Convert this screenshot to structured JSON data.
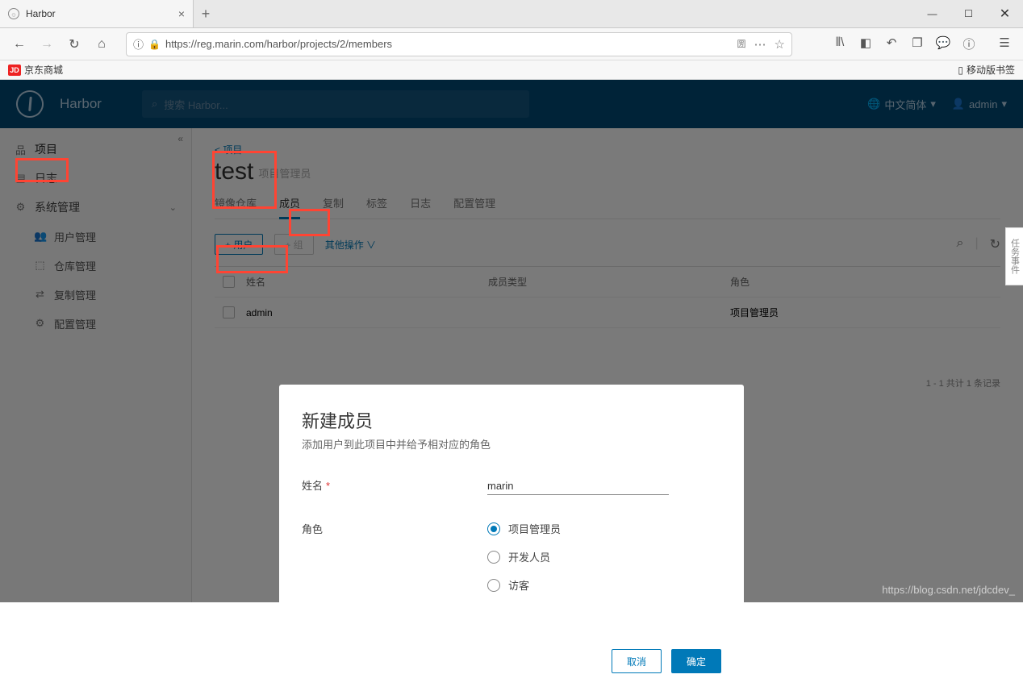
{
  "browser": {
    "tab_title": "Harbor",
    "url": "https://reg.marin.com/harbor/projects/2/members",
    "bookmark1": "京东商城",
    "bookmark2": "移动版书签"
  },
  "header": {
    "brand": "Harbor",
    "search_placeholder": "搜索 Harbor...",
    "lang": "中文简体",
    "user": "admin"
  },
  "sidebar": {
    "projects": "项目",
    "logs": "日志",
    "admin": "系统管理",
    "users": "用户管理",
    "repos": "仓库管理",
    "replication": "复制管理",
    "config": "配置管理"
  },
  "main": {
    "crumb": "< 项目",
    "title": "test",
    "subtitle": "项目管理员",
    "tabs": {
      "repo": "镜像仓库",
      "members": "成员",
      "replication": "复制",
      "labels": "标签",
      "logs": "日志",
      "config": "配置管理"
    },
    "add_user_btn": "+ 用户",
    "add_group_btn": "+ 组",
    "other_ops": "其他操作 ∨",
    "cols": {
      "name": "姓名",
      "type": "成员类型",
      "role": "角色"
    },
    "rows": [
      {
        "name": "admin",
        "type": "",
        "role": "项目管理员"
      }
    ],
    "pagination": "1 - 1 共计 1 条记录"
  },
  "modal": {
    "title": "新建成员",
    "desc": "添加用户到此项目中并给予相对应的角色",
    "name_label": "姓名",
    "name_value": "marin",
    "role_label": "角色",
    "roles": {
      "admin": "项目管理员",
      "dev": "开发人员",
      "guest": "访客"
    },
    "cancel": "取消",
    "ok": "确定"
  },
  "event_tab": "任务事件",
  "watermark": "https://blog.csdn.net/jdcdev_"
}
